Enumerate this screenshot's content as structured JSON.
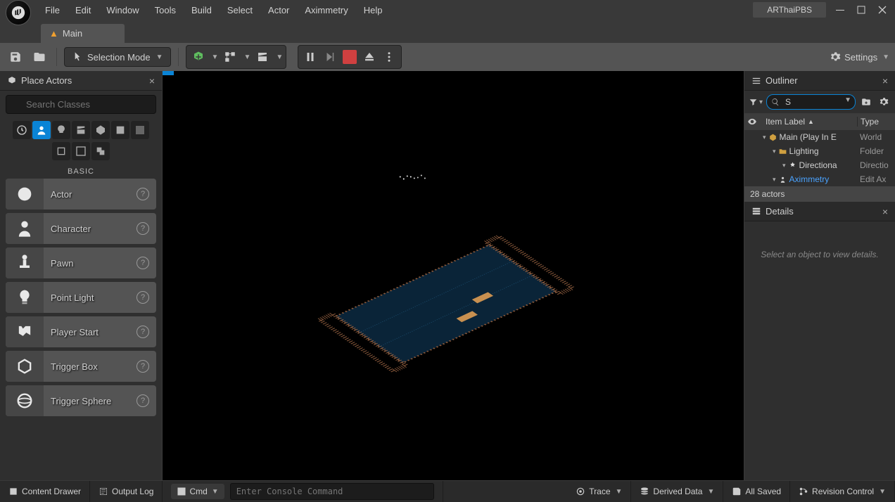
{
  "menu": {
    "items": [
      "File",
      "Edit",
      "Window",
      "Tools",
      "Build",
      "Select",
      "Actor",
      "Aximmetry",
      "Help"
    ]
  },
  "project_name": "ARThaiPBS",
  "tab": {
    "title": "Main"
  },
  "toolbar": {
    "mode": "Selection Mode",
    "settings": "Settings"
  },
  "place_actors": {
    "title": "Place Actors",
    "search_placeholder": "Search Classes",
    "basic": "BASIC",
    "items": [
      {
        "label": "Actor"
      },
      {
        "label": "Character"
      },
      {
        "label": "Pawn"
      },
      {
        "label": "Point Light"
      },
      {
        "label": "Player Start"
      },
      {
        "label": "Trigger Box"
      },
      {
        "label": "Trigger Sphere"
      }
    ]
  },
  "outliner": {
    "title": "Outliner",
    "search_value": "S",
    "col_label": "Item Label",
    "col_type": "Type",
    "rows": [
      {
        "indent": 0,
        "icon": "world",
        "label": "Main (Play In E",
        "type": "World"
      },
      {
        "indent": 1,
        "icon": "folder",
        "label": "Lighting",
        "type": "Folder"
      },
      {
        "indent": 2,
        "icon": "light",
        "label": "Directiona",
        "type": "Directio"
      },
      {
        "indent": 1,
        "icon": "actor",
        "label": "Aximmetry",
        "type": "Edit Ax",
        "link": true
      }
    ],
    "count": "28 actors"
  },
  "details": {
    "title": "Details",
    "empty": "Select an object to view details."
  },
  "status": {
    "content_drawer": "Content Drawer",
    "output_log": "Output Log",
    "cmd": "Cmd",
    "console_placeholder": "Enter Console Command",
    "trace": "Trace",
    "derived": "Derived Data",
    "saved": "All Saved",
    "revision": "Revision Control"
  }
}
